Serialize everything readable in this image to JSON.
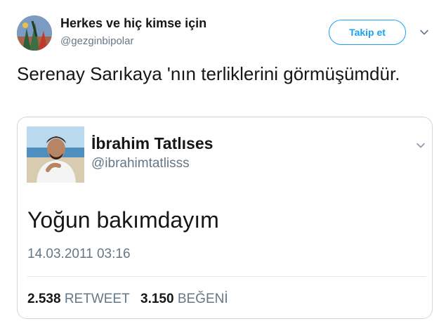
{
  "tweet": {
    "author": {
      "name": "Herkes ve hiç kimse için",
      "handle": "@gezginbipolar"
    },
    "follow_label": "Takip et",
    "text": "Serenay Sarıkaya 'nın terliklerini görmüşümdür.",
    "icons": {
      "menu": "chevron-down-icon"
    }
  },
  "quoted": {
    "author": {
      "name": "İbrahim Tatlıses",
      "handle": "@ibrahimtatlisss"
    },
    "text": "Yoğun bakımdayım",
    "timestamp": "14.03.2011 03:16",
    "stats": {
      "retweet_count": "2.538",
      "retweet_label": "RETWEET",
      "like_count": "3.150",
      "like_label": "BEĞENİ"
    }
  },
  "colors": {
    "accent": "#1da1f2",
    "secondary_text": "#657786",
    "border": "#ccd6dd"
  }
}
